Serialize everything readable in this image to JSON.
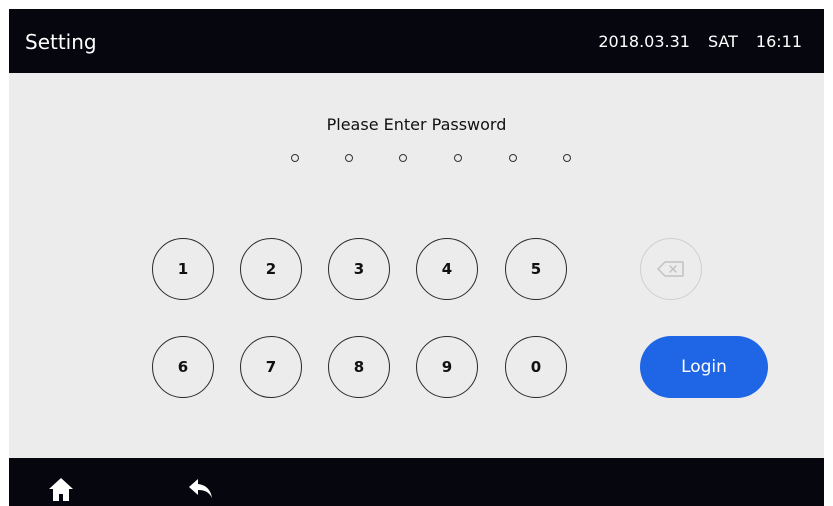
{
  "header": {
    "title": "Setting",
    "date": "2018.03.31",
    "weekday": "SAT",
    "time": "16:11"
  },
  "password": {
    "prompt": "Please Enter Password",
    "length": 6,
    "entered": 0
  },
  "keypad": {
    "keys": [
      "1",
      "2",
      "3",
      "4",
      "5",
      "6",
      "7",
      "8",
      "9",
      "0"
    ],
    "backspace_icon": "backspace-icon",
    "login_label": "Login"
  },
  "footer": {
    "home_icon": "home-icon",
    "back_icon": "back-arrow-icon"
  },
  "colors": {
    "bar": "#06060f",
    "background": "#ececec",
    "accent": "#1f66e6"
  }
}
